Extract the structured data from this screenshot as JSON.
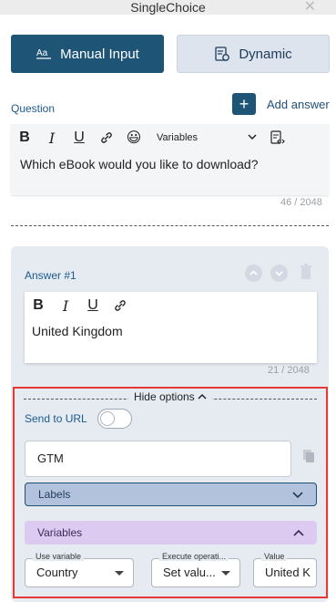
{
  "window": {
    "title": "SingleChoice",
    "close_glyph": "✕"
  },
  "tabs": [
    {
      "label": "Manual Input",
      "icon": "text-format-icon",
      "active": true
    },
    {
      "label": "Dynamic",
      "icon": "dynamic-list-icon",
      "active": false
    }
  ],
  "question": {
    "label": "Question",
    "add_answer_label": "Add answer",
    "toolbar": {
      "bold": "B",
      "italic": "I",
      "underline": "U",
      "emoji": "😃",
      "variables_label": "Variables"
    },
    "text": "Which eBook would you like to download?",
    "counter": "46 / 2048"
  },
  "answer": {
    "title": "Answer #1",
    "toolbar": {
      "bold": "B",
      "italic": "I",
      "underline": "U"
    },
    "text": "United Kingdom",
    "counter": "21 / 2048",
    "options": {
      "hide_label": "Hide options",
      "send_to_url_label": "Send to URL",
      "send_to_url_enabled": false,
      "gtm_value": "GTM",
      "labels_label": "Labels",
      "variables_label": "Variables",
      "use_variable": {
        "label": "Use variable",
        "value": "Country"
      },
      "execute_operation": {
        "label": "Execute operati...",
        "value": "Set valu..."
      },
      "value_field": {
        "label": "Value",
        "value": "United K"
      }
    }
  },
  "colors": {
    "primary": "#1e5577",
    "link": "#1c5a8c",
    "labels_bg": "#b3c2dc",
    "variables_bg": "#dccaf0",
    "highlight": "#e53935"
  }
}
